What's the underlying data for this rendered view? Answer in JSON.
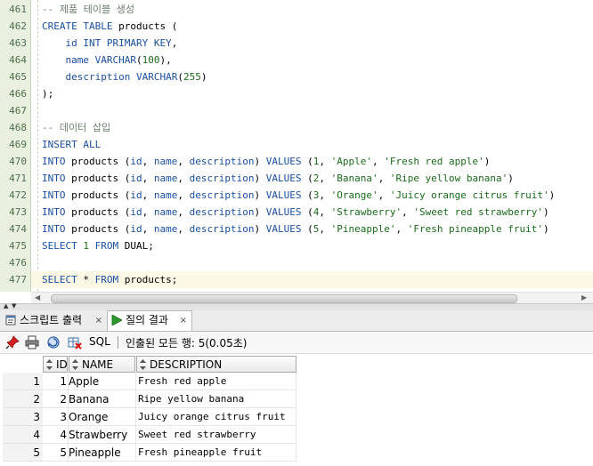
{
  "editor": {
    "lines": [
      {
        "n": "461",
        "tokens": [
          {
            "t": "-- 제품 테이블 생성",
            "c": "cm"
          }
        ]
      },
      {
        "n": "462",
        "tokens": [
          {
            "t": "CREATE TABLE",
            "c": "kw"
          },
          {
            "t": " products (",
            "c": "pn"
          }
        ]
      },
      {
        "n": "463",
        "tokens": [
          {
            "t": "    id ",
            "c": "kw"
          },
          {
            "t": "INT PRIMARY KEY",
            "c": "kw"
          },
          {
            "t": ",",
            "c": "pn"
          }
        ]
      },
      {
        "n": "464",
        "tokens": [
          {
            "t": "    name ",
            "c": "kw"
          },
          {
            "t": "VARCHAR",
            "c": "kw"
          },
          {
            "t": "(",
            "c": "pn"
          },
          {
            "t": "100",
            "c": "num"
          },
          {
            "t": "),",
            "c": "pn"
          }
        ]
      },
      {
        "n": "465",
        "tokens": [
          {
            "t": "    description ",
            "c": "kw"
          },
          {
            "t": "VARCHAR",
            "c": "kw"
          },
          {
            "t": "(",
            "c": "pn"
          },
          {
            "t": "255",
            "c": "num"
          },
          {
            "t": ")",
            "c": "pn"
          }
        ]
      },
      {
        "n": "466",
        "tokens": [
          {
            "t": ");",
            "c": "pn"
          }
        ]
      },
      {
        "n": "467",
        "tokens": []
      },
      {
        "n": "468",
        "tokens": [
          {
            "t": "-- 데이터 삽입",
            "c": "cm"
          }
        ]
      },
      {
        "n": "469",
        "tokens": [
          {
            "t": "INSERT ALL",
            "c": "kw"
          }
        ]
      },
      {
        "n": "470",
        "tokens": [
          {
            "t": "INTO",
            "c": "kw"
          },
          {
            "t": " products (",
            "c": "pn"
          },
          {
            "t": "id",
            "c": "kw"
          },
          {
            "t": ", ",
            "c": "pn"
          },
          {
            "t": "name",
            "c": "kw"
          },
          {
            "t": ", ",
            "c": "pn"
          },
          {
            "t": "description",
            "c": "kw"
          },
          {
            "t": ") ",
            "c": "pn"
          },
          {
            "t": "VALUES",
            "c": "kw"
          },
          {
            "t": " (",
            "c": "pn"
          },
          {
            "t": "1",
            "c": "num"
          },
          {
            "t": ", ",
            "c": "pn"
          },
          {
            "t": "'Apple'",
            "c": "str"
          },
          {
            "t": ", ",
            "c": "pn"
          },
          {
            "t": "'Fresh red apple'",
            "c": "str"
          },
          {
            "t": ")",
            "c": "pn"
          }
        ]
      },
      {
        "n": "471",
        "tokens": [
          {
            "t": "INTO",
            "c": "kw"
          },
          {
            "t": " products (",
            "c": "pn"
          },
          {
            "t": "id",
            "c": "kw"
          },
          {
            "t": ", ",
            "c": "pn"
          },
          {
            "t": "name",
            "c": "kw"
          },
          {
            "t": ", ",
            "c": "pn"
          },
          {
            "t": "description",
            "c": "kw"
          },
          {
            "t": ") ",
            "c": "pn"
          },
          {
            "t": "VALUES",
            "c": "kw"
          },
          {
            "t": " (",
            "c": "pn"
          },
          {
            "t": "2",
            "c": "num"
          },
          {
            "t": ", ",
            "c": "pn"
          },
          {
            "t": "'Banana'",
            "c": "str"
          },
          {
            "t": ", ",
            "c": "pn"
          },
          {
            "t": "'Ripe yellow banana'",
            "c": "str"
          },
          {
            "t": ")",
            "c": "pn"
          }
        ]
      },
      {
        "n": "472",
        "tokens": [
          {
            "t": "INTO",
            "c": "kw"
          },
          {
            "t": " products (",
            "c": "pn"
          },
          {
            "t": "id",
            "c": "kw"
          },
          {
            "t": ", ",
            "c": "pn"
          },
          {
            "t": "name",
            "c": "kw"
          },
          {
            "t": ", ",
            "c": "pn"
          },
          {
            "t": "description",
            "c": "kw"
          },
          {
            "t": ") ",
            "c": "pn"
          },
          {
            "t": "VALUES",
            "c": "kw"
          },
          {
            "t": " (",
            "c": "pn"
          },
          {
            "t": "3",
            "c": "num"
          },
          {
            "t": ", ",
            "c": "pn"
          },
          {
            "t": "'Orange'",
            "c": "str"
          },
          {
            "t": ", ",
            "c": "pn"
          },
          {
            "t": "'Juicy orange citrus fruit'",
            "c": "str"
          },
          {
            "t": ")",
            "c": "pn"
          }
        ]
      },
      {
        "n": "473",
        "tokens": [
          {
            "t": "INTO",
            "c": "kw"
          },
          {
            "t": " products (",
            "c": "pn"
          },
          {
            "t": "id",
            "c": "kw"
          },
          {
            "t": ", ",
            "c": "pn"
          },
          {
            "t": "name",
            "c": "kw"
          },
          {
            "t": ", ",
            "c": "pn"
          },
          {
            "t": "description",
            "c": "kw"
          },
          {
            "t": ") ",
            "c": "pn"
          },
          {
            "t": "VALUES",
            "c": "kw"
          },
          {
            "t": " (",
            "c": "pn"
          },
          {
            "t": "4",
            "c": "num"
          },
          {
            "t": ", ",
            "c": "pn"
          },
          {
            "t": "'Strawberry'",
            "c": "str"
          },
          {
            "t": ", ",
            "c": "pn"
          },
          {
            "t": "'Sweet red strawberry'",
            "c": "str"
          },
          {
            "t": ")",
            "c": "pn"
          }
        ]
      },
      {
        "n": "474",
        "tokens": [
          {
            "t": "INTO",
            "c": "kw"
          },
          {
            "t": " products (",
            "c": "pn"
          },
          {
            "t": "id",
            "c": "kw"
          },
          {
            "t": ", ",
            "c": "pn"
          },
          {
            "t": "name",
            "c": "kw"
          },
          {
            "t": ", ",
            "c": "pn"
          },
          {
            "t": "description",
            "c": "kw"
          },
          {
            "t": ") ",
            "c": "pn"
          },
          {
            "t": "VALUES",
            "c": "kw"
          },
          {
            "t": " (",
            "c": "pn"
          },
          {
            "t": "5",
            "c": "num"
          },
          {
            "t": ", ",
            "c": "pn"
          },
          {
            "t": "'Pineapple'",
            "c": "str"
          },
          {
            "t": ", ",
            "c": "pn"
          },
          {
            "t": "'Fresh pineapple fruit'",
            "c": "str"
          },
          {
            "t": ")",
            "c": "pn"
          }
        ]
      },
      {
        "n": "475",
        "tokens": [
          {
            "t": "SELECT",
            "c": "kw"
          },
          {
            "t": " ",
            "c": "pn"
          },
          {
            "t": "1",
            "c": "num"
          },
          {
            "t": " ",
            "c": "pn"
          },
          {
            "t": "FROM",
            "c": "kw"
          },
          {
            "t": " DUAL;",
            "c": "pn"
          }
        ]
      },
      {
        "n": "476",
        "tokens": []
      },
      {
        "n": "477",
        "tokens": [
          {
            "t": "SELECT",
            "c": "kw"
          },
          {
            "t": " * ",
            "c": "pn"
          },
          {
            "t": "FROM",
            "c": "kw"
          },
          {
            "t": " products;",
            "c": "pn"
          }
        ]
      }
    ],
    "current_line": "477"
  },
  "tabs": [
    {
      "label": "스크립트 출력",
      "icon": "script-output-icon"
    },
    {
      "label": "질의 결과",
      "icon": "run-query-icon"
    }
  ],
  "toolbar": {
    "sql_label": "SQL",
    "status": "인출된 모든 행: 5(0.05초)"
  },
  "grid": {
    "columns": [
      "ID",
      "NAME",
      "DESCRIPTION"
    ],
    "rows": [
      {
        "rownum": "1",
        "id": "1",
        "name": "Apple",
        "description": "Fresh red apple"
      },
      {
        "rownum": "2",
        "id": "2",
        "name": "Banana",
        "description": "Ripe yellow banana"
      },
      {
        "rownum": "3",
        "id": "3",
        "name": "Orange",
        "description": "Juicy orange citrus fruit"
      },
      {
        "rownum": "4",
        "id": "4",
        "name": "Strawberry",
        "description": "Sweet red strawberry"
      },
      {
        "rownum": "5",
        "id": "5",
        "name": "Pineapple",
        "description": "Fresh pineapple fruit"
      }
    ]
  },
  "colors": {
    "keyword": "#1a4fa0",
    "string": "#1a6b1a",
    "comment": "#6b7f6b",
    "gutter": "#e9f0e0"
  }
}
